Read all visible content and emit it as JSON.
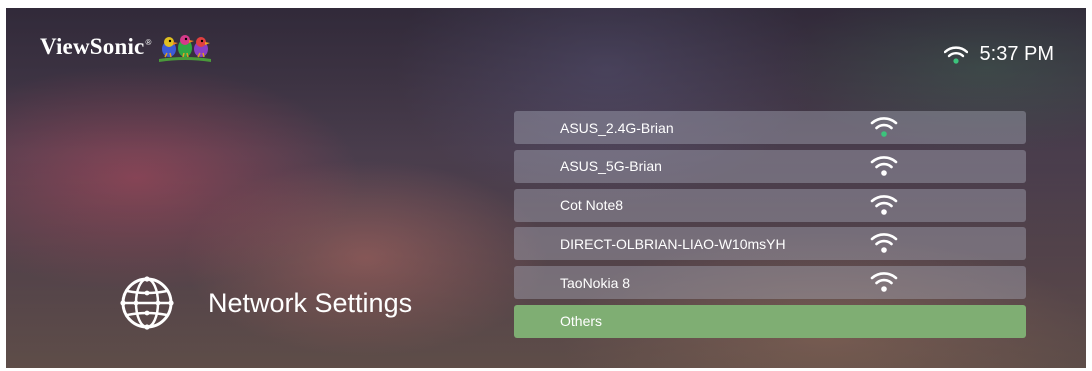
{
  "brand": {
    "name": "ViewSonic",
    "registered": "®"
  },
  "status_bar": {
    "time": "5:37 PM",
    "wifi_icon": "wifi-icon",
    "wifi_color": "#3cc47c"
  },
  "section": {
    "title": "Network Settings",
    "icon": "globe-network-icon"
  },
  "networks": [
    {
      "name": "ASUS_2.4G-Brian",
      "signal_icon": "wifi-signal-icon",
      "connected": true
    },
    {
      "name": "ASUS_5G-Brian",
      "signal_icon": "wifi-signal-icon",
      "connected": false
    },
    {
      "name": "Cot Note8",
      "signal_icon": "wifi-signal-icon",
      "connected": false
    },
    {
      "name": "DIRECT-OLBRIAN-LIAO-W10msYH",
      "signal_icon": "wifi-signal-icon",
      "connected": false
    },
    {
      "name": "TaoNokia 8",
      "signal_icon": "wifi-signal-icon",
      "connected": false
    }
  ],
  "others": {
    "label": "Others",
    "selected": true
  },
  "colors": {
    "selected_row": "#7fae73",
    "row": "#aaacb9",
    "connected_dot": "#3cc47c",
    "text": "#ffffff"
  }
}
